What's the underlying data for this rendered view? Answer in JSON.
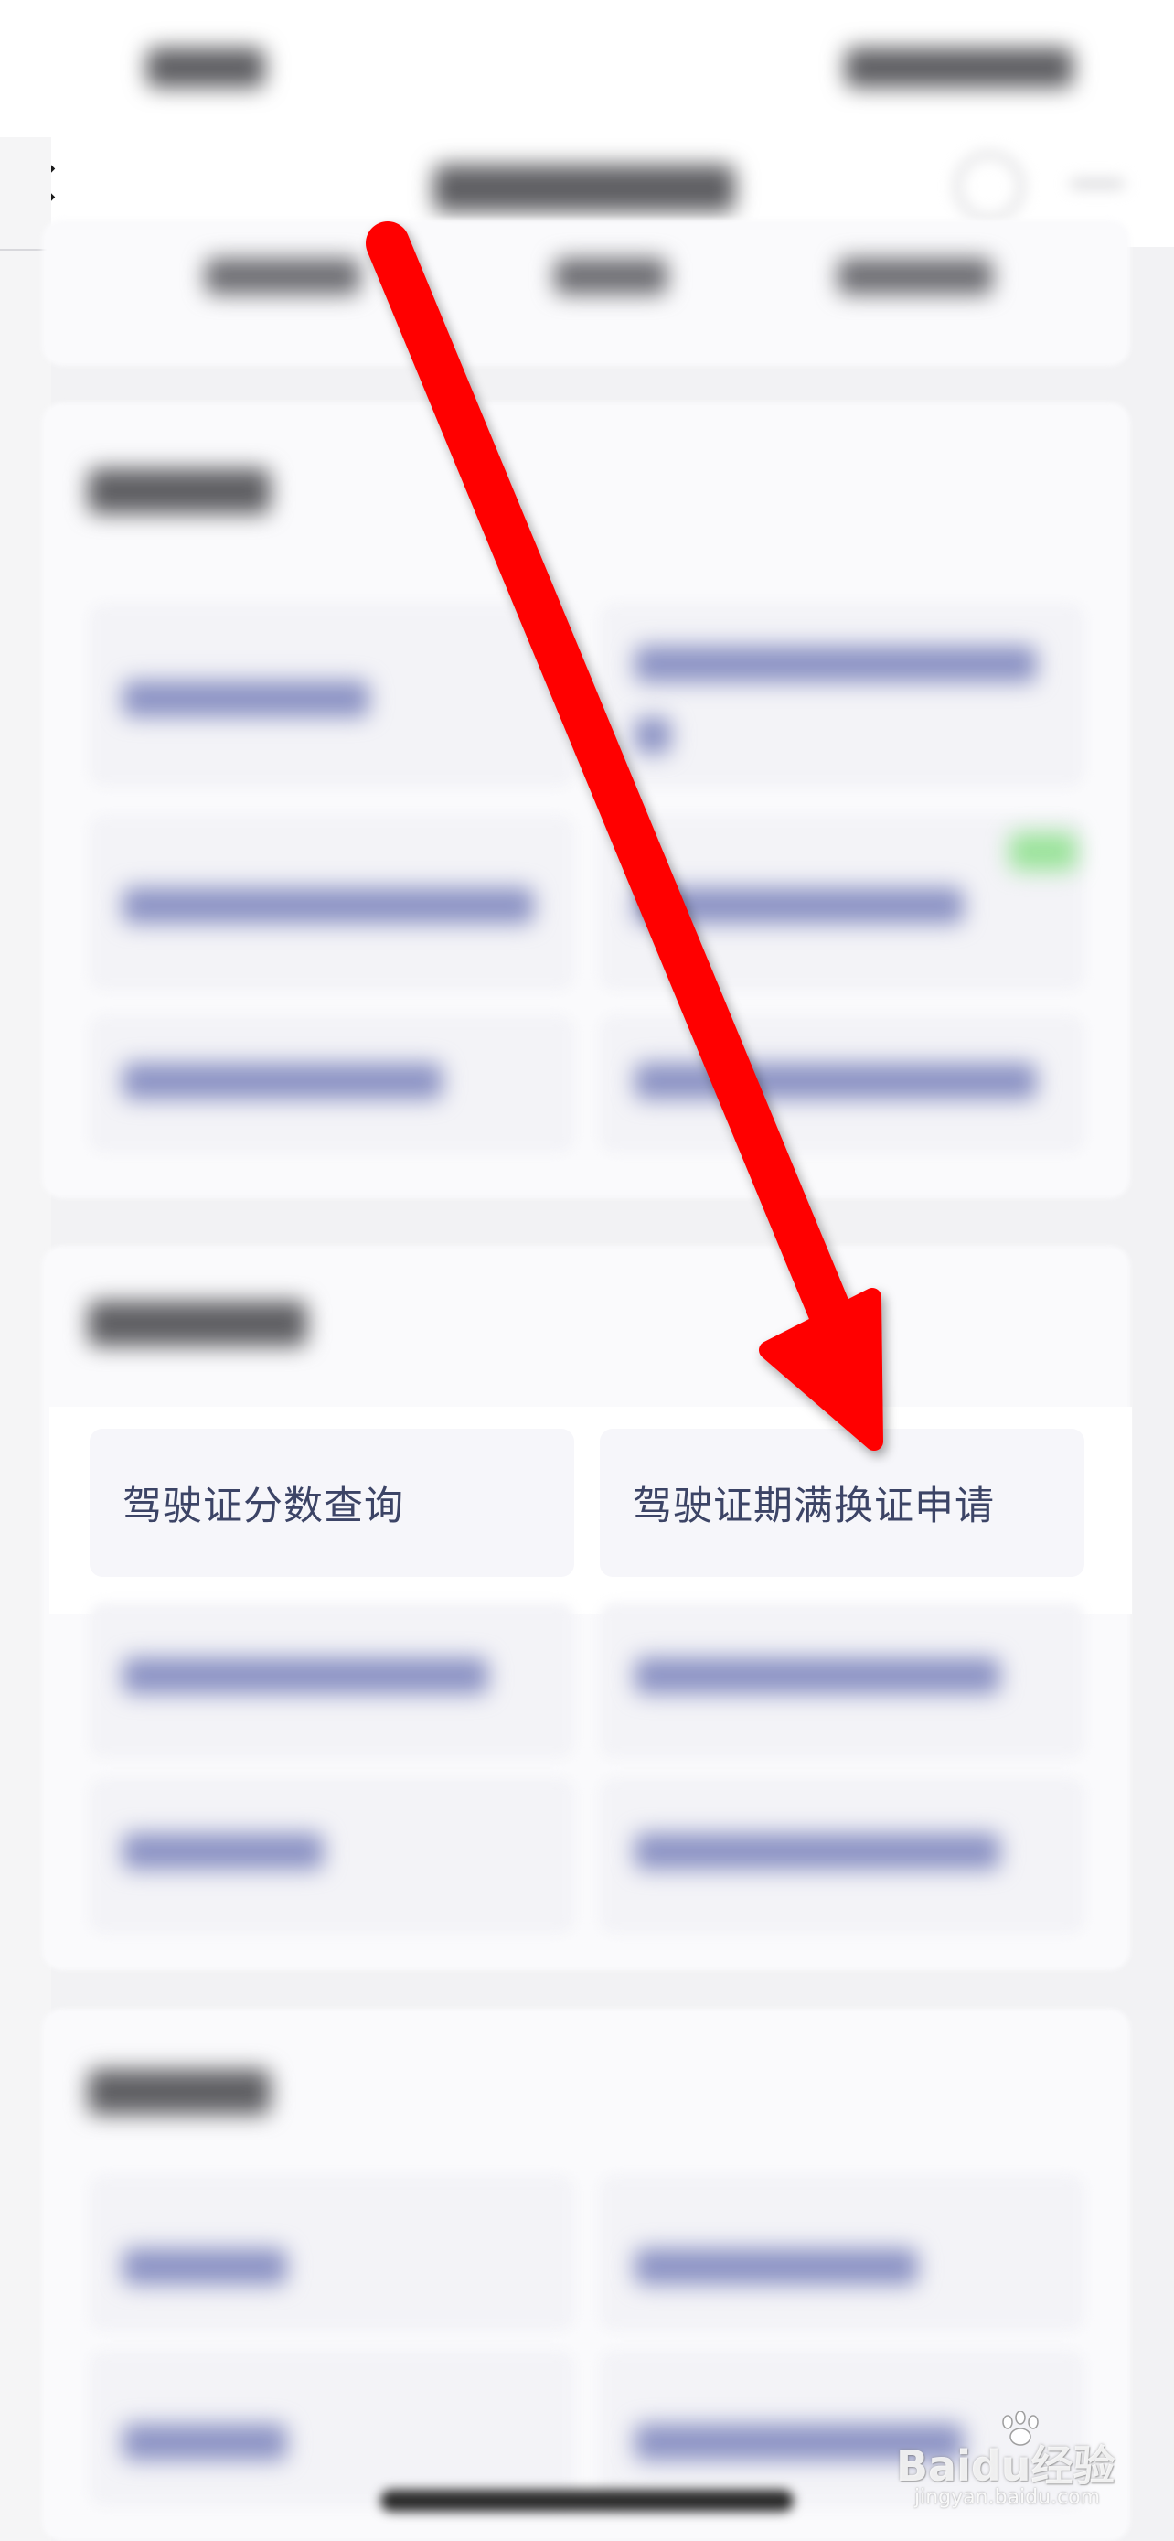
{
  "section_center": {
    "items": [
      {
        "label": "驾驶证分数查询"
      },
      {
        "label": "驾驶证期满换证申请"
      }
    ]
  },
  "watermark": {
    "brand": "Baidu经验",
    "domain": "jingyan.baidu.com"
  },
  "colors": {
    "page_bg": "#f2f2f4",
    "card_bg": "#fafafc",
    "link_text": "#3c4466",
    "arrow": "#ff0000"
  },
  "icons": {
    "back": "chevron-left-icon",
    "nav_target": "target-icon",
    "nav_more": "more-icon"
  }
}
